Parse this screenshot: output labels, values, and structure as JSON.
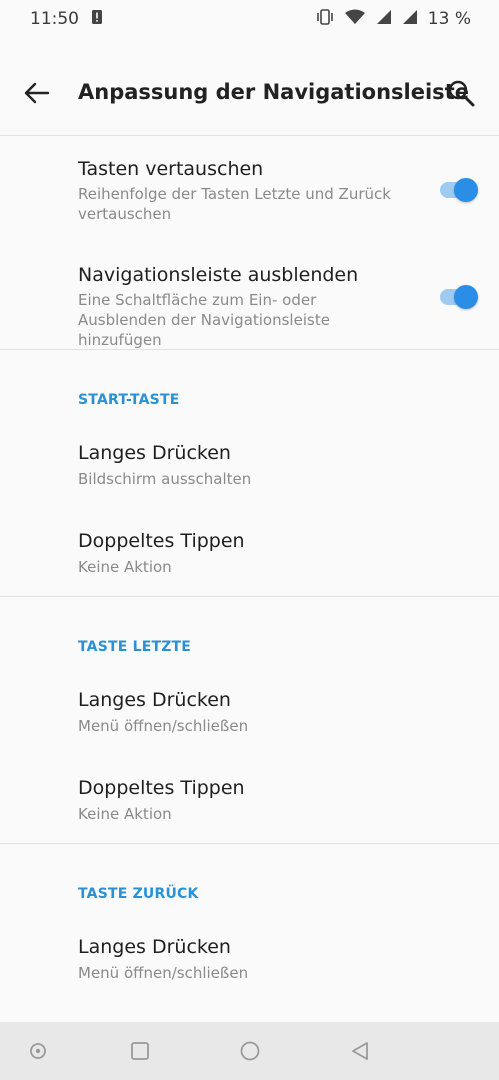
{
  "status_bar": {
    "time": "11:50",
    "battery": "13 %",
    "icons": [
      "alert-icon",
      "vibrate-icon",
      "wifi-icon",
      "signal-icon",
      "signal-icon",
      "battery-icon"
    ]
  },
  "toolbar": {
    "title": "Anpassung der Navigationsleiste",
    "back_icon": "arrow-left-icon",
    "search_icon": "search-icon"
  },
  "toggles": [
    {
      "title": "Tasten vertauschen",
      "summary": "Reihenfolge der Tasten Letzte und Zurück vertauschen",
      "enabled": true
    },
    {
      "title": "Navigationsleiste ausblenden",
      "summary": "Eine Schaltfläche zum Ein- oder Ausblenden der Navigationsleiste hinzufügen",
      "enabled": true
    }
  ],
  "sections": [
    {
      "header": "START-TASTE",
      "items": [
        {
          "title": "Langes Drücken",
          "summary": "Bildschirm ausschalten"
        },
        {
          "title": "Doppeltes Tippen",
          "summary": "Keine Aktion"
        }
      ]
    },
    {
      "header": "TASTE LETZTE",
      "items": [
        {
          "title": "Langes Drücken",
          "summary": "Menü öffnen/schließen"
        },
        {
          "title": "Doppeltes Tippen",
          "summary": "Keine Aktion"
        }
      ]
    },
    {
      "header": "TASTE ZURÜCK",
      "items": [
        {
          "title": "Langes Drücken",
          "summary": "Menü öffnen/schließen"
        }
      ]
    }
  ],
  "nav_bar": {
    "buttons": [
      "assistant-icon",
      "recents-icon",
      "home-icon",
      "back-icon"
    ]
  },
  "colors": {
    "accent": "#2a91d6",
    "switch_thumb": "#2a8ee6",
    "switch_track": "#9ecbf2",
    "background": "#fafafa",
    "nav_bar": "#e8e8e8"
  }
}
